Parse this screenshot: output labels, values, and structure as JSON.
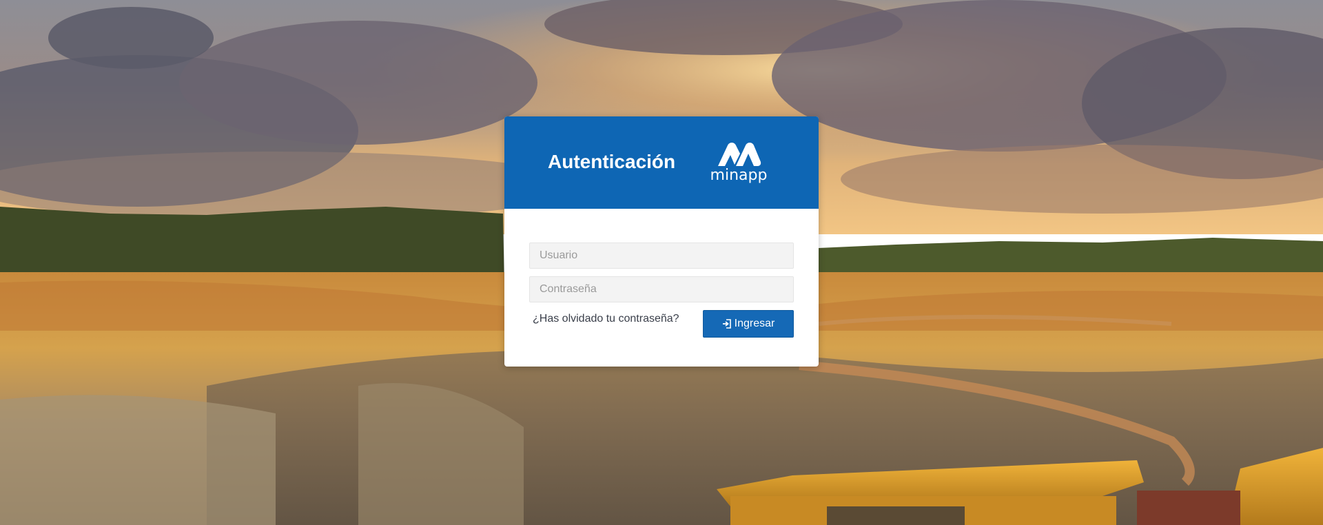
{
  "login": {
    "title": "Autenticación",
    "logo_text": "minapp",
    "username_placeholder": "Usuario",
    "password_placeholder": "Contraseña",
    "forgot_password_label": "¿Has olvidado tu contraseña?",
    "submit_label": "Ingresar",
    "submit_icon": "sign-in-icon"
  },
  "colors": {
    "header": "#0e66b4",
    "button": "#1569b6"
  }
}
